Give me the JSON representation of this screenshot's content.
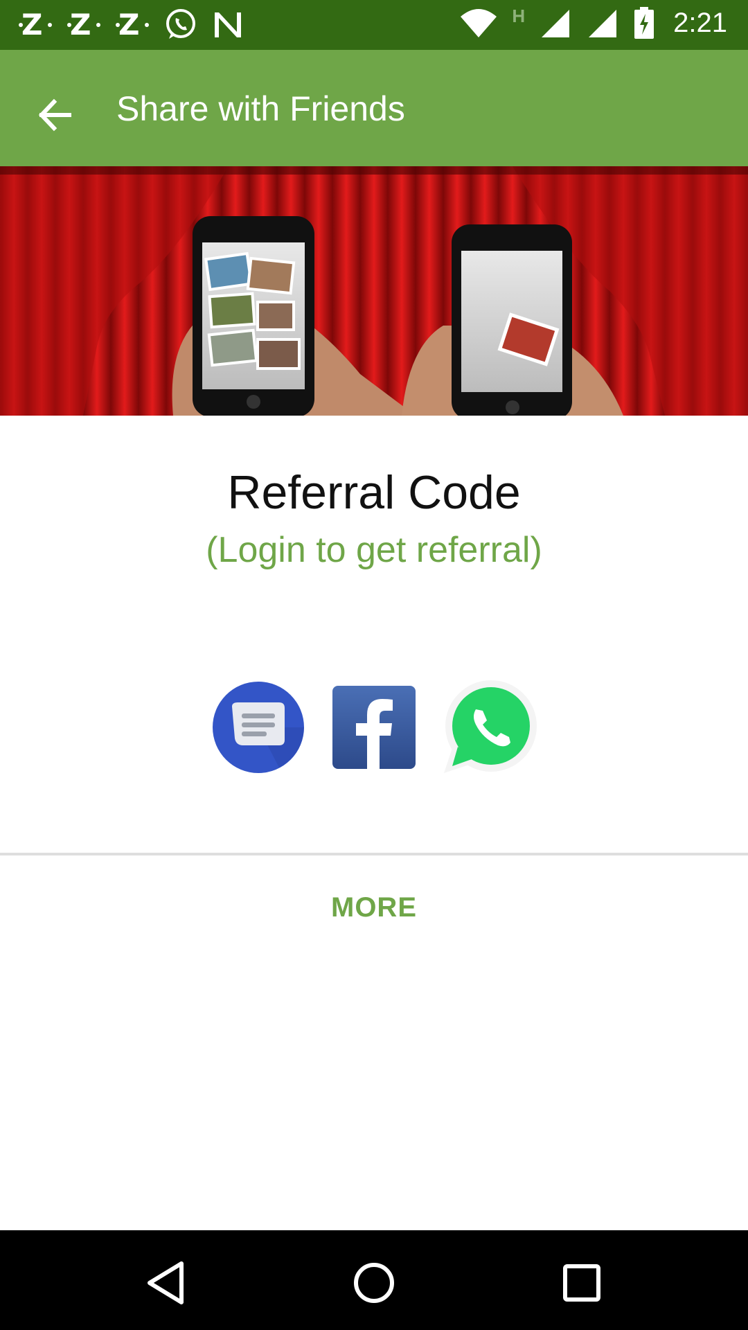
{
  "status_bar": {
    "time": "2:21",
    "left_icons": [
      "z-notification-icon",
      "z-notification-icon",
      "z-notification-icon",
      "whatsapp-notification-icon",
      "n-notification-icon"
    ],
    "right_icons": [
      "wifi-icon",
      "h-network-icon",
      "signal-icon",
      "signal-icon",
      "battery-charging-icon"
    ],
    "network_label": "H"
  },
  "app_bar": {
    "title": "Share with Friends",
    "back_icon": "arrow-back-icon"
  },
  "banner": {
    "image": "curtains-phones-banner"
  },
  "referral": {
    "title": "Referral Code",
    "subtitle": "(Login to get referral)"
  },
  "share_options": [
    {
      "icon": "messages-icon",
      "color": "#3355c7"
    },
    {
      "icon": "facebook-icon",
      "color": "#3b5998"
    },
    {
      "icon": "whatsapp-icon",
      "color": "#25d366"
    }
  ],
  "more_button": {
    "label": "MORE"
  },
  "colors": {
    "status_bar": "#336a13",
    "app_bar": "#6fa648",
    "accent": "#6fa648"
  },
  "nav_bar": {
    "icons": [
      "back-triangle-icon",
      "home-circle-icon",
      "recents-square-icon"
    ]
  }
}
